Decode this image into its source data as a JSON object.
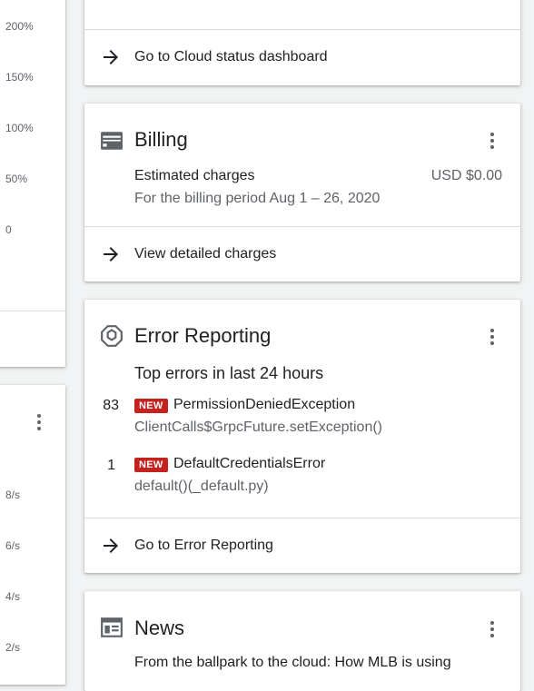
{
  "left_chart_1": {
    "y_ticks": [
      "200%",
      "150%",
      "100%",
      "50%",
      "0"
    ]
  },
  "left_chart_2": {
    "y_ticks": [
      "8/s",
      "6/s",
      "4/s",
      "2/s"
    ]
  },
  "status_card": {
    "link_label": "Go to Cloud status dashboard"
  },
  "billing": {
    "title": "Billing",
    "charges_label": "Estimated charges",
    "charges_value": "USD $0.00",
    "period": "For the billing period Aug 1 – 26, 2020",
    "link_label": "View detailed charges"
  },
  "error_reporting": {
    "title": "Error Reporting",
    "subtitle": "Top errors in last 24 hours",
    "errors": [
      {
        "count": "83",
        "badge": "NEW",
        "name": "PermissionDeniedException",
        "location": "ClientCalls$GrpcFuture.setException()"
      },
      {
        "count": "1",
        "badge": "NEW",
        "name": "DefaultCredentialsError",
        "location": "default()(_default.py)"
      }
    ],
    "link_label": "Go to Error Reporting"
  },
  "news": {
    "title": "News",
    "headline": "From the ballpark to the cloud: How MLB is using"
  },
  "colors": {
    "badge_red": "#c5221f",
    "icon_grey": "#5f6368"
  }
}
